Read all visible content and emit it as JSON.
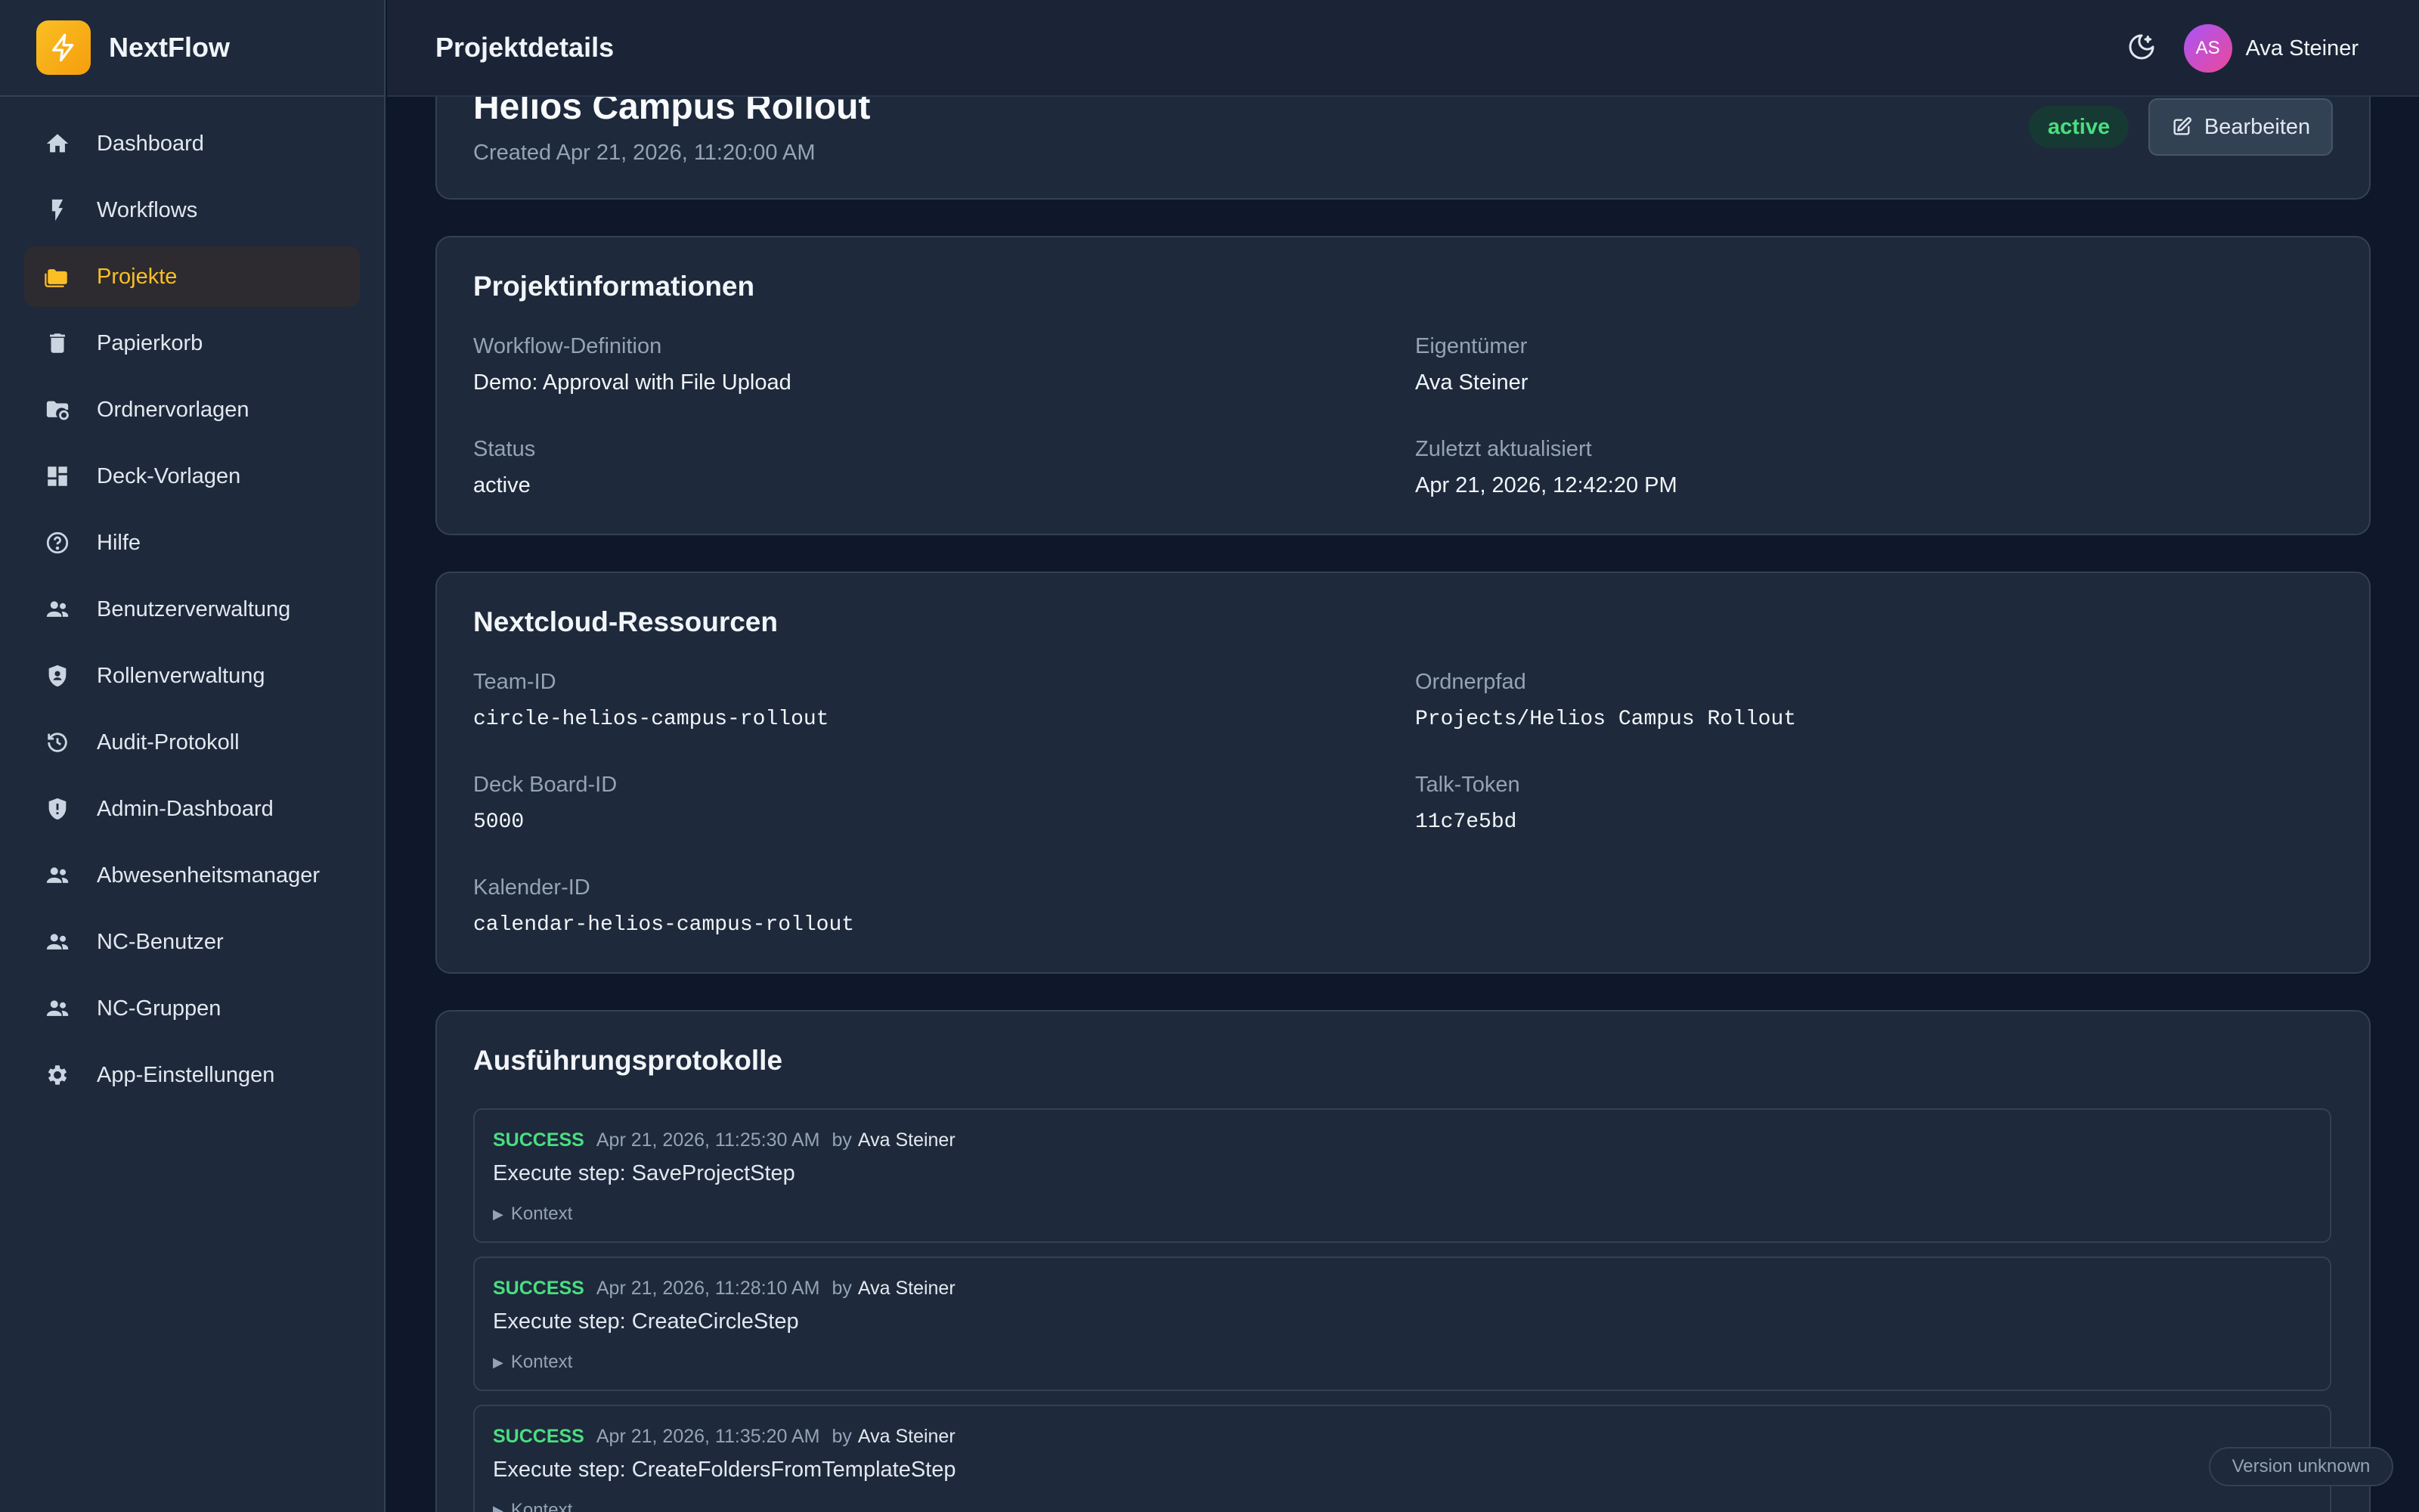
{
  "app": {
    "name": "NextFlow"
  },
  "header": {
    "title": "Projektdetails",
    "user_initials": "AS",
    "user_name": "Ava Steiner"
  },
  "sidebar": {
    "items": [
      {
        "label": "Dashboard",
        "icon": "home-icon"
      },
      {
        "label": "Workflows",
        "icon": "bolt-icon"
      },
      {
        "label": "Projekte",
        "icon": "folder-icon",
        "active": true
      },
      {
        "label": "Papierkorb",
        "icon": "trash-icon"
      },
      {
        "label": "Ordnervorlagen",
        "icon": "folder-settings-icon"
      },
      {
        "label": "Deck-Vorlagen",
        "icon": "dashboard-grid-icon"
      },
      {
        "label": "Hilfe",
        "icon": "help-icon"
      },
      {
        "label": "Benutzerverwaltung",
        "icon": "users-icon"
      },
      {
        "label": "Rollenverwaltung",
        "icon": "shield-user-icon"
      },
      {
        "label": "Audit-Protokoll",
        "icon": "history-icon"
      },
      {
        "label": "Admin-Dashboard",
        "icon": "shield-icon"
      },
      {
        "label": "Abwesenheitsmanager",
        "icon": "users-icon"
      },
      {
        "label": "NC-Benutzer",
        "icon": "users-icon"
      },
      {
        "label": "NC-Gruppen",
        "icon": "users-icon"
      },
      {
        "label": "App-Einstellungen",
        "icon": "gear-icon"
      }
    ]
  },
  "project": {
    "title": "Helios Campus Rollout",
    "created": "Created Apr 21, 2026, 11:20:00 AM",
    "status_badge": "active",
    "edit_label": "Bearbeiten"
  },
  "info": {
    "title": "Projektinformationen",
    "workflow_label": "Workflow-Definition",
    "workflow_value": "Demo: Approval with File Upload",
    "owner_label": "Eigentümer",
    "owner_value": "Ava Steiner",
    "status_label": "Status",
    "status_value": "active",
    "updated_label": "Zuletzt aktualisiert",
    "updated_value": "Apr 21, 2026, 12:42:20 PM"
  },
  "resources": {
    "title": "Nextcloud-Ressourcen",
    "team_label": "Team-ID",
    "team_value": "circle-helios-campus-rollout",
    "folder_label": "Ordnerpfad",
    "folder_value": "Projects/Helios Campus Rollout",
    "deck_label": "Deck Board-ID",
    "deck_value": "5000",
    "talk_label": "Talk-Token",
    "talk_value": "11c7e5bd",
    "calendar_label": "Kalender-ID",
    "calendar_value": "calendar-helios-campus-rollout"
  },
  "logs": {
    "title": "Ausführungsprotokolle",
    "by_label": "by",
    "context_label": "Kontext",
    "entries": [
      {
        "status": "SUCCESS",
        "time": "Apr 21, 2026, 11:25:30 AM",
        "user": "Ava Steiner",
        "message": "Execute step: SaveProjectStep"
      },
      {
        "status": "SUCCESS",
        "time": "Apr 21, 2026, 11:28:10 AM",
        "user": "Ava Steiner",
        "message": "Execute step: CreateCircleStep"
      },
      {
        "status": "SUCCESS",
        "time": "Apr 21, 2026, 11:35:20 AM",
        "user": "Ava Steiner",
        "message": "Execute step: CreateFoldersFromTemplateStep"
      }
    ]
  },
  "footer": {
    "version": "Version unknown"
  },
  "colors": {
    "accent": "#fbbf24",
    "success": "#4ade80",
    "background": "#0f172a",
    "surface": "#1e293b"
  }
}
